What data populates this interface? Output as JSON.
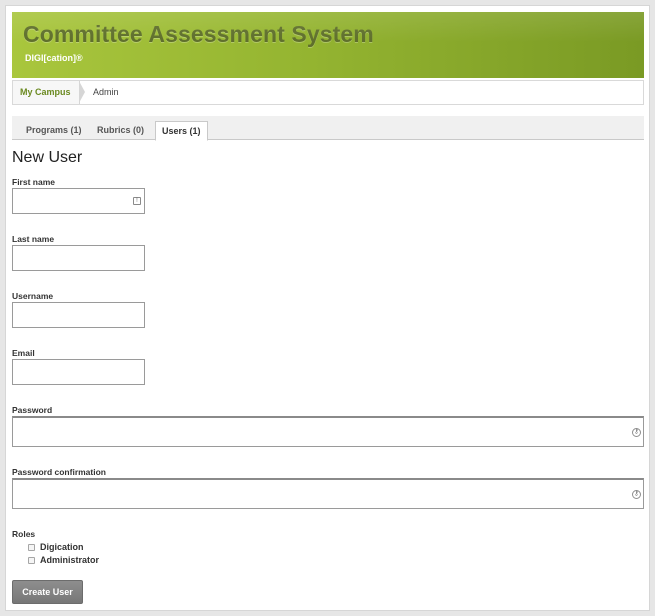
{
  "header": {
    "title": "Committee Assessment System",
    "subtitle": "DIGI[cation]®"
  },
  "breadcrumb": {
    "home": "My Campus",
    "current": "Admin"
  },
  "tabs": [
    {
      "label": "Programs (1)",
      "active": false
    },
    {
      "label": "Rubrics (0)",
      "active": false
    },
    {
      "label": "Users (1)",
      "active": true
    }
  ],
  "form": {
    "heading": "New User",
    "first_name_label": "First name",
    "first_name_value": "",
    "last_name_label": "Last name",
    "last_name_value": "",
    "username_label": "Username",
    "username_value": "",
    "email_label": "Email",
    "email_value": "",
    "password_label": "Password",
    "password_confirmation_label": "Password confirmation",
    "roles_label": "Roles",
    "roles": [
      {
        "label": "Digication",
        "checked": false
      },
      {
        "label": "Administrator",
        "checked": false
      }
    ],
    "submit_label": "Create User"
  },
  "icons": {
    "first_name_field": "autofill-contact-icon",
    "password_fields": "key-icon"
  },
  "colors": {
    "banner_green": "#95b531",
    "breadcrumb_link": "#6b8a21",
    "submit_button": "#808080"
  }
}
